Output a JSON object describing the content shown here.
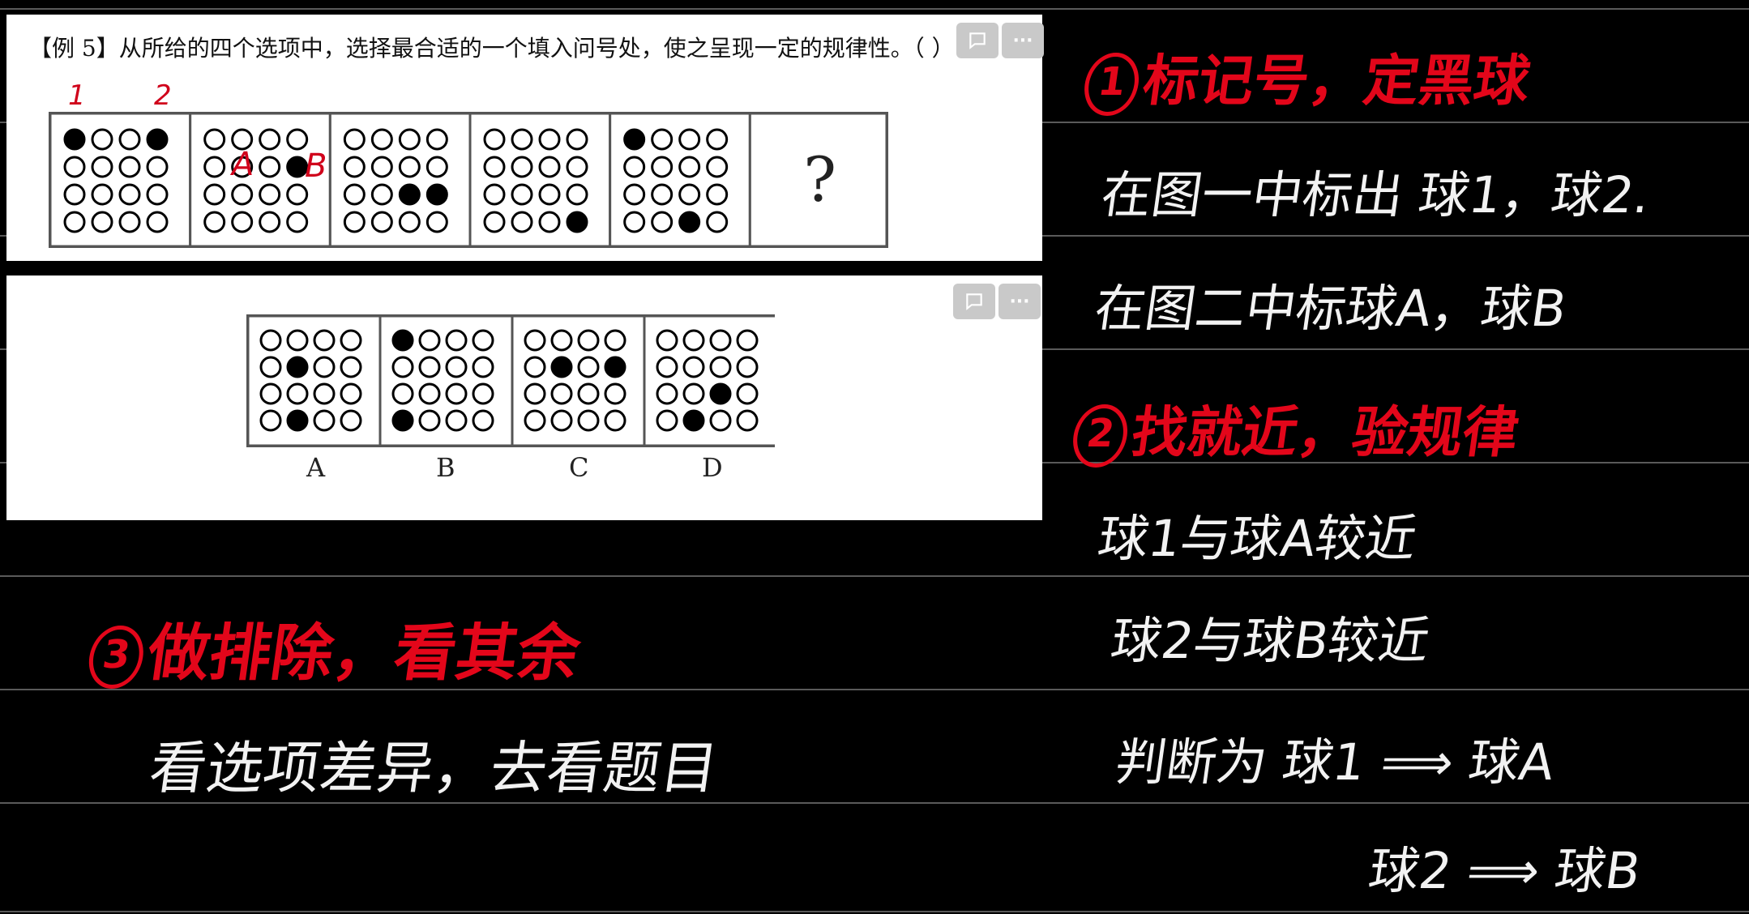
{
  "question": {
    "text": "【例 5】从所给的四个选项中，选择最合适的一个填入问号处，使之呈现一定的规律性。（ ）"
  },
  "toolbar": {
    "comment_icon": "comment-icon",
    "more_icon": "more-dots-icon",
    "more_label": "···"
  },
  "sequence": {
    "question_mark": "?",
    "marks": {
      "ball_1": "1",
      "ball_2": "2",
      "ball_a": "A",
      "ball_b": "B"
    },
    "panels": [
      {
        "filled": [
          [
            0,
            0
          ],
          [
            0,
            3
          ]
        ]
      },
      {
        "filled": [
          [
            1,
            3
          ]
        ]
      },
      {
        "filled": [
          [
            2,
            2
          ],
          [
            2,
            3
          ]
        ]
      },
      {
        "filled": [
          [
            3,
            3
          ]
        ]
      },
      {
        "filled": [
          [
            0,
            0
          ],
          [
            3,
            2
          ]
        ]
      }
    ]
  },
  "options": {
    "panels": [
      {
        "label": "A",
        "filled": [
          [
            1,
            1
          ],
          [
            3,
            1
          ]
        ]
      },
      {
        "label": "B",
        "filled": [
          [
            0,
            0
          ],
          [
            3,
            0
          ]
        ]
      },
      {
        "label": "C",
        "filled": [
          [
            1,
            1
          ],
          [
            1,
            3
          ]
        ]
      },
      {
        "label": "D",
        "filled": [
          [
            2,
            2
          ],
          [
            3,
            1
          ]
        ]
      }
    ]
  },
  "notes": {
    "step1_num": "1",
    "step1_title": "标记号，定黑球",
    "step1_line1": "在图一中标出 球1，球2.",
    "step1_line2": "在图二中标球A，球B",
    "step2_num": "2",
    "step2_title": "找就近，验规律",
    "step2_line1": "球1与球A较近",
    "step2_line2": "球2与球B较近",
    "step2_line3": "判断为 球1 ⟹ 球A",
    "step2_line4": "球2 ⟹ 球B",
    "step3_num": "3",
    "step3_title": "做排除，看其余",
    "step3_line1": "看选项差异，去看题目"
  },
  "colors": {
    "background": "#000000",
    "ink_red": "#e3061a",
    "ink_white": "#f2f2f2",
    "card": "#ffffff"
  }
}
